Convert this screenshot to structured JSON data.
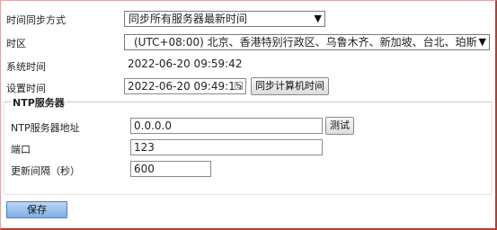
{
  "form": {
    "sync_mode": {
      "label": "时间同步方式",
      "value": "同步所有服务器最新时间",
      "arrow": "▼"
    },
    "timezone": {
      "label": "时区",
      "value": "(UTC+08:00)  北京、香港特别行政区、乌鲁木齐、新加坡、台北、珀斯",
      "arrow": "▼"
    },
    "system_time": {
      "label": "系统时间",
      "value": "2022-06-20 09:59:42"
    },
    "set_time": {
      "label": "设置时间",
      "value": "2022-06-20 09:49:15",
      "sync_pc_button": "同步计算机时间"
    }
  },
  "ntp": {
    "section_title": "NTP服务器",
    "server_address": {
      "label": "NTP服务器地址",
      "value": "0.0.0.0",
      "test_button": "测试"
    },
    "port": {
      "label": "端口",
      "value": "123"
    },
    "update_interval": {
      "label": "更新间隔（秒）",
      "value": "600"
    }
  },
  "actions": {
    "save_label": "保存"
  },
  "colors": {
    "save_button": "#7eaee6",
    "frame_accent": "#c0392b"
  }
}
